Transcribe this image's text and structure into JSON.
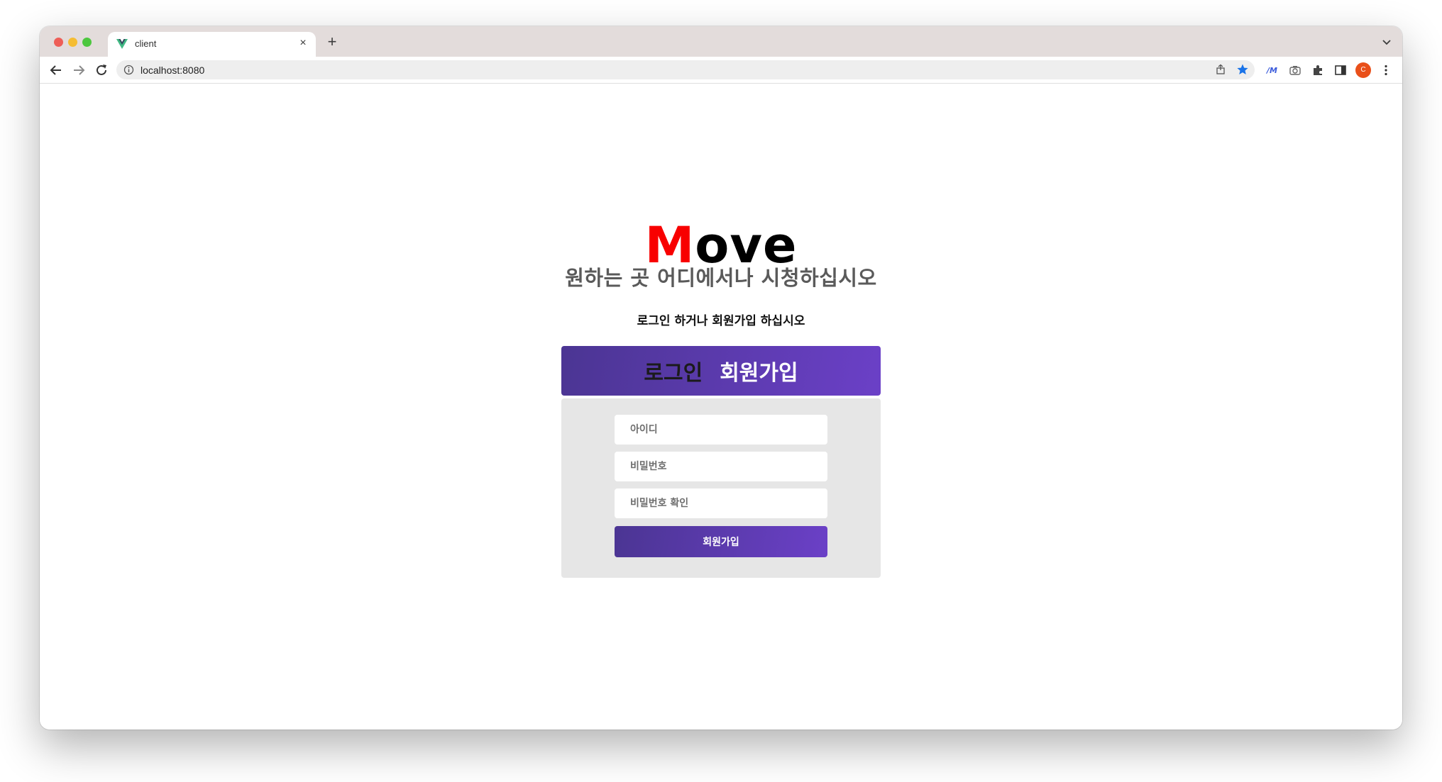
{
  "browser": {
    "tab": {
      "title": "client",
      "close_glyph": "×"
    },
    "new_tab_glyph": "+",
    "address_bar": {
      "url": "localhost:8080"
    },
    "profile": {
      "initial": "C"
    },
    "colors": {
      "tabbar": "#e3dcdb",
      "star": "#1a73e8",
      "profile": "#e9501a"
    }
  },
  "page": {
    "logo": {
      "first_letter": "M",
      "rest": "ove"
    },
    "headline": "원하는 곳 어디에서나 시청하십시오",
    "subline": "로그인 하거나 회원가입 하십시오",
    "tabs": {
      "login": "로그인",
      "signup": "회원가입"
    },
    "form": {
      "id_placeholder": "아이디",
      "password_placeholder": "비밀번호",
      "password_confirm_placeholder": "비밀번호 확인",
      "submit_label": "회원가입"
    },
    "colors": {
      "logo_accent": "#f80000",
      "button_gradient_start": "#4b3593",
      "button_gradient_end": "#6b40c7",
      "form_bg": "#e6e6e6"
    }
  }
}
